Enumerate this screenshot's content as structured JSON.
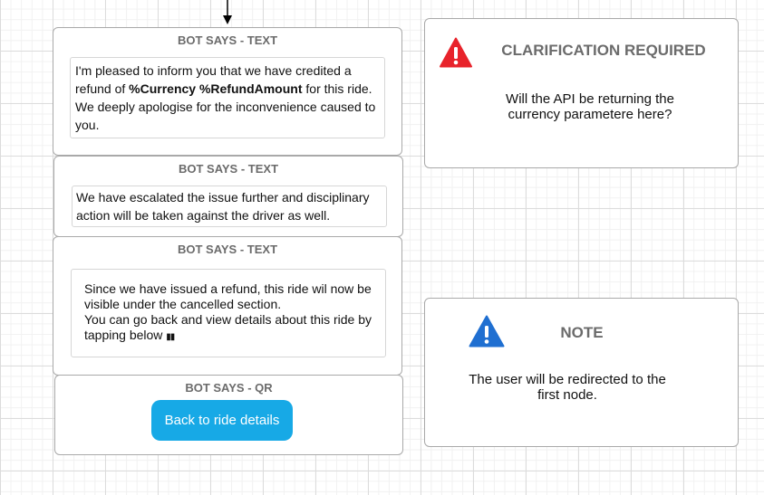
{
  "cards": [
    {
      "title": "BOT SAYS - TEXT",
      "lines": [
        "I'm pleased to inform you that we have credited a",
        "We deeply apologise for the inconvenience caused to",
        "you."
      ],
      "line2": {
        "before": "refund of ",
        "bold": "%Currency %RefundAmount",
        "after": " for this ride."
      }
    },
    {
      "title": "BOT SAYS - TEXT",
      "lines": [
        "We have escalated the issue further and disciplinary",
        "action will be taken against the driver as well."
      ]
    },
    {
      "title": "BOT SAYS - TEXT",
      "lines": [
        "Since we have issued a refund, this ride wil now be",
        "visible under the cancelled section.",
        "You can go back and view details about this ride by",
        "tapping below"
      ],
      "emoji": "▮▮"
    },
    {
      "title": "BOT SAYS - QR",
      "button": "Back to ride details"
    }
  ],
  "clarification": {
    "title": "CLARIFICATION REQUIRED",
    "line1": "Will the API be returning the",
    "line2": "currency parametere here?",
    "icon": "warning-icon",
    "color": "#e8232b"
  },
  "note": {
    "title": "NOTE",
    "line1": "The user will be redirected to the",
    "line2": "first node.",
    "icon": "info-icon",
    "color": "#1f6fd1"
  }
}
